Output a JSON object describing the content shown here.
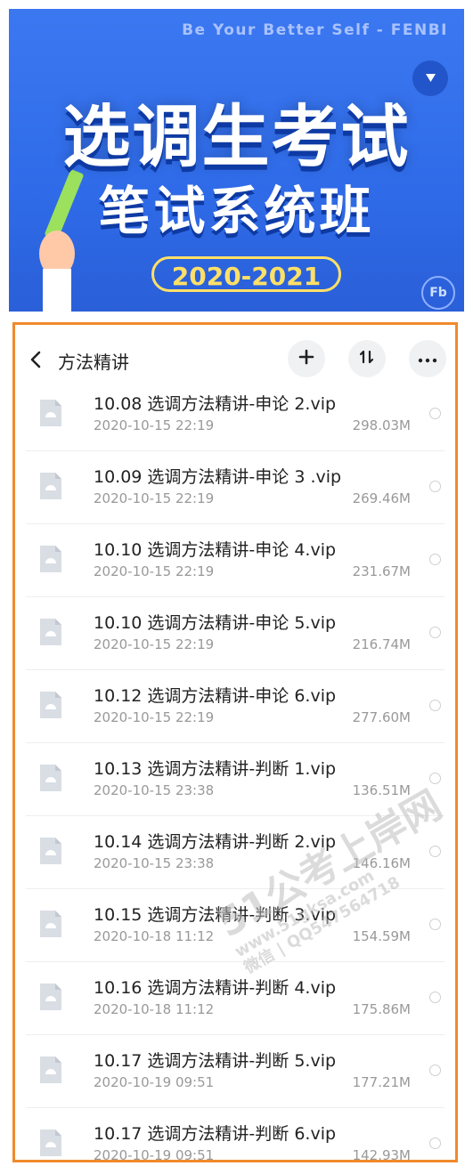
{
  "banner": {
    "tagline": "Be Your Better Self - FENBI",
    "title_line1": "选调生考试",
    "title_line2": "笔试系统班",
    "year": "2020-2021",
    "badge": "Fb"
  },
  "navbar": {
    "title": "方法精讲",
    "icons": [
      "back-icon",
      "plus-icon",
      "sort-icon",
      "more-icon"
    ]
  },
  "files": [
    {
      "name": "10.08 选调方法精讲-申论 2.vip",
      "date": "2020-10-15 22:19",
      "size": "298.03M"
    },
    {
      "name": "10.09 选调方法精讲-申论 3 .vip",
      "date": "2020-10-15 22:19",
      "size": "269.46M"
    },
    {
      "name": "10.10 选调方法精讲-申论 4.vip",
      "date": "2020-10-15 22:19",
      "size": "231.67M"
    },
    {
      "name": "10.10 选调方法精讲-申论 5.vip",
      "date": "2020-10-15 22:19",
      "size": "216.74M"
    },
    {
      "name": "10.12 选调方法精讲-申论 6.vip",
      "date": "2020-10-15 22:19",
      "size": "277.60M"
    },
    {
      "name": "10.13 选调方法精讲-判断 1.vip",
      "date": "2020-10-15 23:38",
      "size": "136.51M"
    },
    {
      "name": "10.14 选调方法精讲-判断 2.vip",
      "date": "2020-10-15 23:38",
      "size": "146.16M"
    },
    {
      "name": "10.15 选调方法精讲-判断 3.vip",
      "date": "2020-10-18 11:12",
      "size": "154.59M"
    },
    {
      "name": "10.16 选调方法精讲-判断 4.vip",
      "date": "2020-10-18 11:12",
      "size": "175.86M"
    },
    {
      "name": "10.17 选调方法精讲-判断 5.vip",
      "date": "2020-10-19 09:51",
      "size": "177.21M"
    },
    {
      "name": "10.17 选调方法精讲-判断 6.vip",
      "date": "2020-10-19 09:51",
      "size": "142.93M"
    }
  ],
  "watermark": {
    "line1": "51公考上岸网",
    "line2": "www.51gksa.com",
    "line3": "微信 | QQ547564718"
  },
  "colors": {
    "frame": "#f08a2c",
    "banner": "#2f6be8",
    "year": "#ffe066"
  }
}
